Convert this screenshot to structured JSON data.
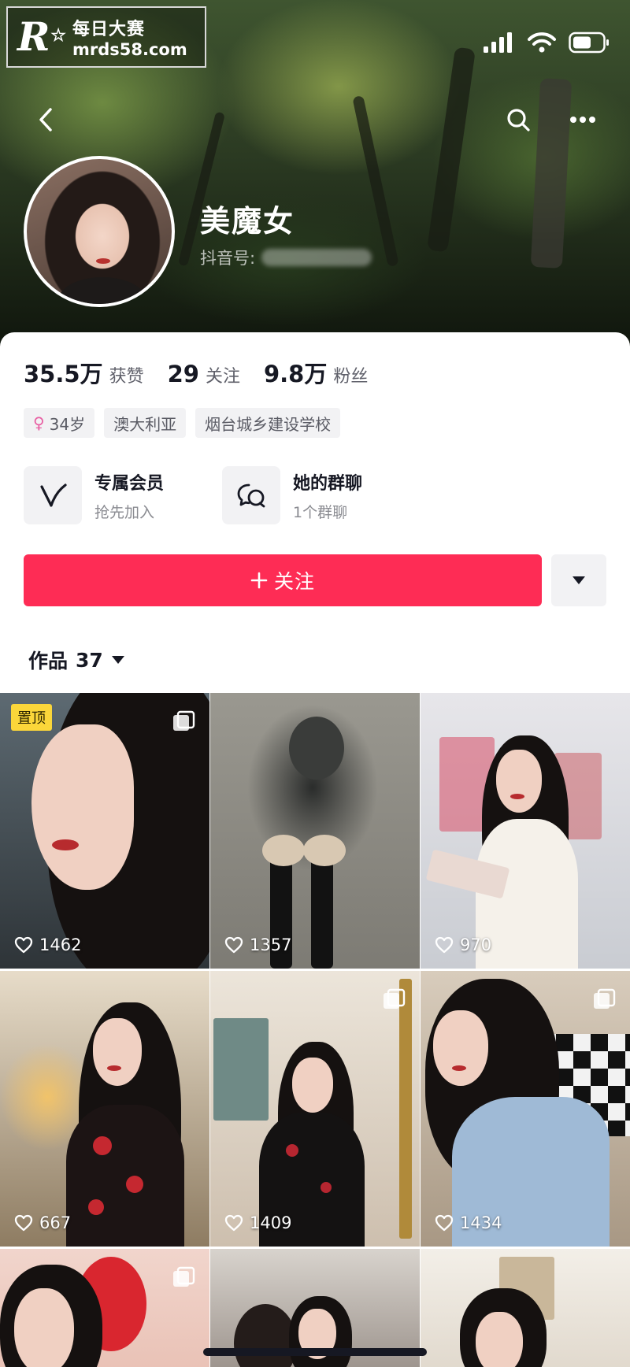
{
  "watermark": {
    "title": "每日大赛",
    "url": "mrds58.com"
  },
  "profile": {
    "name": "美魔女",
    "id_label": "抖音号:"
  },
  "stats": [
    {
      "value": "35.5万",
      "label": "获赞"
    },
    {
      "value": "29",
      "label": "关注"
    },
    {
      "value": "9.8万",
      "label": "粉丝"
    }
  ],
  "tags": {
    "age": "34岁",
    "location": "澳大利亚",
    "school": "烟台城乡建设学校"
  },
  "features": {
    "membership": {
      "title": "专属会员",
      "subtitle": "抢先加入"
    },
    "group_chat": {
      "title": "她的群聊",
      "subtitle": "1个群聊"
    }
  },
  "follow_button": {
    "label": "关注"
  },
  "works": {
    "label": "作品",
    "count": "37"
  },
  "videos": [
    {
      "likes": "1462",
      "pinned_label": "置顶",
      "multi": true
    },
    {
      "likes": "1357"
    },
    {
      "likes": "970"
    },
    {
      "likes": "667"
    },
    {
      "likes": "1409",
      "multi": true
    },
    {
      "likes": "1434",
      "multi": true
    },
    {
      "likes": "",
      "multi": true
    },
    {
      "likes": ""
    },
    {
      "likes": ""
    }
  ],
  "colors": {
    "accent": "#fe2c55",
    "pin": "#fbd63a",
    "gender": "#e85fa3"
  },
  "icons": [
    "back-arrow-icon",
    "search-icon",
    "more-icon",
    "signal-icon",
    "wifi-icon",
    "battery-icon",
    "membership-v-icon",
    "group-chat-icon",
    "dropdown-triangle-icon",
    "heart-icon",
    "multi-image-icon",
    "female-icon"
  ]
}
